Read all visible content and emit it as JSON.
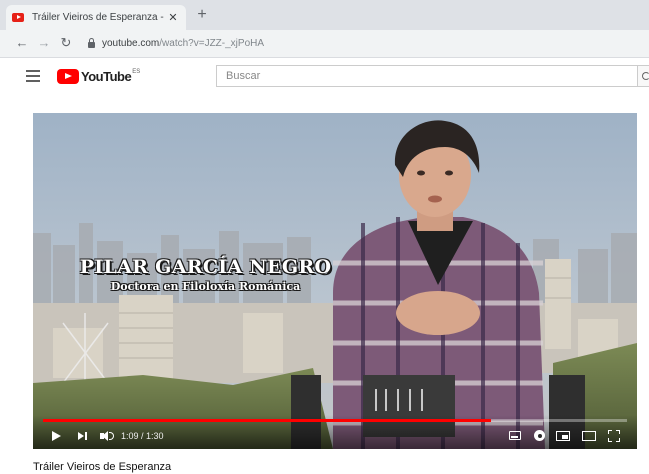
{
  "browser": {
    "tab_title": "Tráiler Vieiros de Esperanza - Yo",
    "tab_close": "✕",
    "new_tab": "+",
    "url_host": "youtube.com",
    "url_path": "/watch?v=JZZ-_xjPoHA"
  },
  "youtube": {
    "logo_text": "YouTube",
    "country_code": "ES",
    "search_placeholder": "Buscar"
  },
  "video": {
    "overlay_name": "PILAR GARCÍA NEGRO",
    "overlay_role": "Doctora en Filoloxía Románica",
    "time_display": "1:09 / 1:30",
    "progress": 0.767,
    "title": "Tráiler Vieiros de Esperanza"
  },
  "colors": {
    "brand_red": "#ff0000",
    "progress_red": "#ff0000"
  }
}
